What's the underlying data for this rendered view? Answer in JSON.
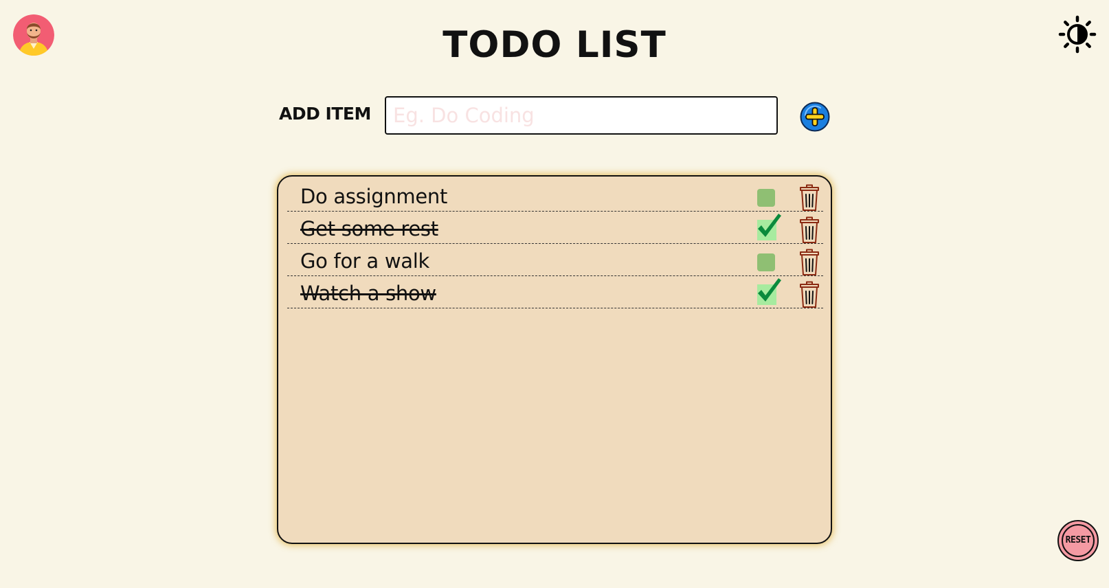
{
  "header": {
    "title": "TODO LIST",
    "avatar_icon": "user-avatar-icon",
    "theme_toggle_icon": "contrast-sun-icon"
  },
  "add_item": {
    "label": "ADD ITEM",
    "input_value": "",
    "placeholder": "Eg. Do Coding",
    "add_button_icon": "plus-circle-icon"
  },
  "todos": [
    {
      "text": "Do assignment",
      "done": false
    },
    {
      "text": "Get some rest",
      "done": true
    },
    {
      "text": "Go for a walk",
      "done": false
    },
    {
      "text": "Watch a show",
      "done": true
    }
  ],
  "item_icons": {
    "checkbox_icon": "checkbox-icon",
    "checked_icon": "checkmark-icon",
    "delete_icon": "trash-icon"
  },
  "reset": {
    "label": "RESET"
  },
  "colors": {
    "background": "#f9f5e6",
    "panel": "#f0dbbd",
    "panel_glow": "#e2b240",
    "checkbox_unchecked": "#8fbf73",
    "checkbox_checked": "#a7eb9f",
    "checkmark": "#0b8a3c",
    "trash": "#8b2a12",
    "add_button": "#1b7fe0",
    "add_plus": "#ffd21f",
    "reset_button": "#f49aa3"
  }
}
